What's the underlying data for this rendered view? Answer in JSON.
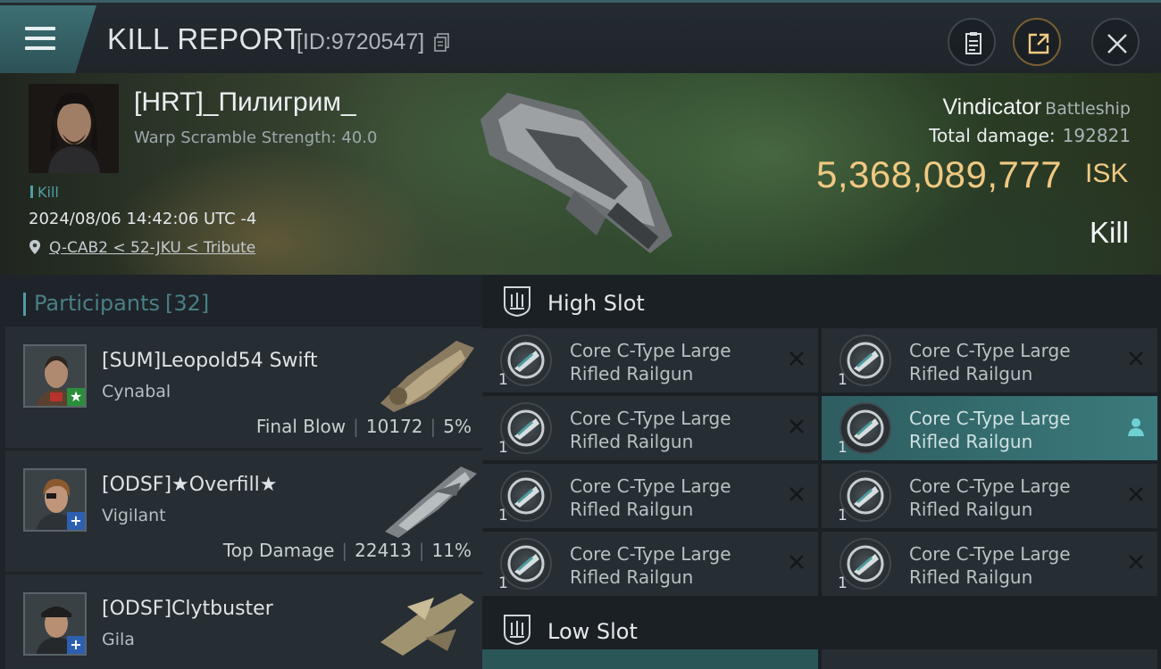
{
  "header": {
    "title": "KILL REPORT",
    "report_id": "[ID:9720547]",
    "icons": [
      "menu-icon",
      "copy-icon",
      "notes-icon",
      "share-icon",
      "close-icon"
    ]
  },
  "victim": {
    "name": "[HRT]_Пилигрим_",
    "scram": "Warp Scramble Strength: 40.0",
    "tag": "Kill",
    "datetime": "2024/08/06 14:42:06 UTC -4",
    "location": "Q-CAB2 < 52-JKU < Tribute",
    "ship": "Vindicator",
    "ship_class": "Battleship",
    "total_damage_label": "Total damage:",
    "total_damage": "192821",
    "isk_value": "5,368,089,777",
    "isk_unit": "ISK",
    "result": "Kill"
  },
  "participants": {
    "title": "Participants",
    "count": "[32]",
    "rows": [
      {
        "name": "[SUM]Leopold54 Swift",
        "ship": "Cynabal",
        "role": "Final Blow",
        "damage": "10172",
        "percent": "5%",
        "badge": "★"
      },
      {
        "name": "[ODSF]★Overfill★",
        "ship": "Vigilant",
        "role": "Top Damage",
        "damage": "22413",
        "percent": "11%",
        "badge": "+"
      },
      {
        "name": "[ODSF]Clytbuster",
        "ship": "Gila",
        "badge": "+"
      }
    ]
  },
  "fitting": {
    "high_slot_label": "High Slot",
    "low_slot_label": "Low Slot",
    "modules": [
      {
        "line1": "Core C-Type Large",
        "line2": "Rifled Railgun",
        "qty": "1"
      },
      {
        "line1": "Core C-Type Large",
        "line2": "Rifled Railgun",
        "qty": "1"
      },
      {
        "line1": "Core C-Type Large",
        "line2": "Rifled Railgun",
        "qty": "1"
      },
      {
        "line1": "Core C-Type Large",
        "line2": "Rifled Railgun",
        "qty": "1"
      },
      {
        "line1": "Core C-Type Large",
        "line2": "Rifled Railgun",
        "qty": "1"
      },
      {
        "line1": "Core C-Type Large",
        "line2": "Rifled Railgun",
        "qty": "1"
      },
      {
        "line1": "Core C-Type Large",
        "line2": "Rifled Railgun",
        "qty": "1"
      },
      {
        "line1": "Core C-Type Large",
        "line2": "Rifled Railgun",
        "qty": "1"
      }
    ]
  },
  "colors": {
    "accent_teal": "#4f9ea3",
    "isk_gold": "#f0c982",
    "selected_module": "#3b7a7c"
  }
}
